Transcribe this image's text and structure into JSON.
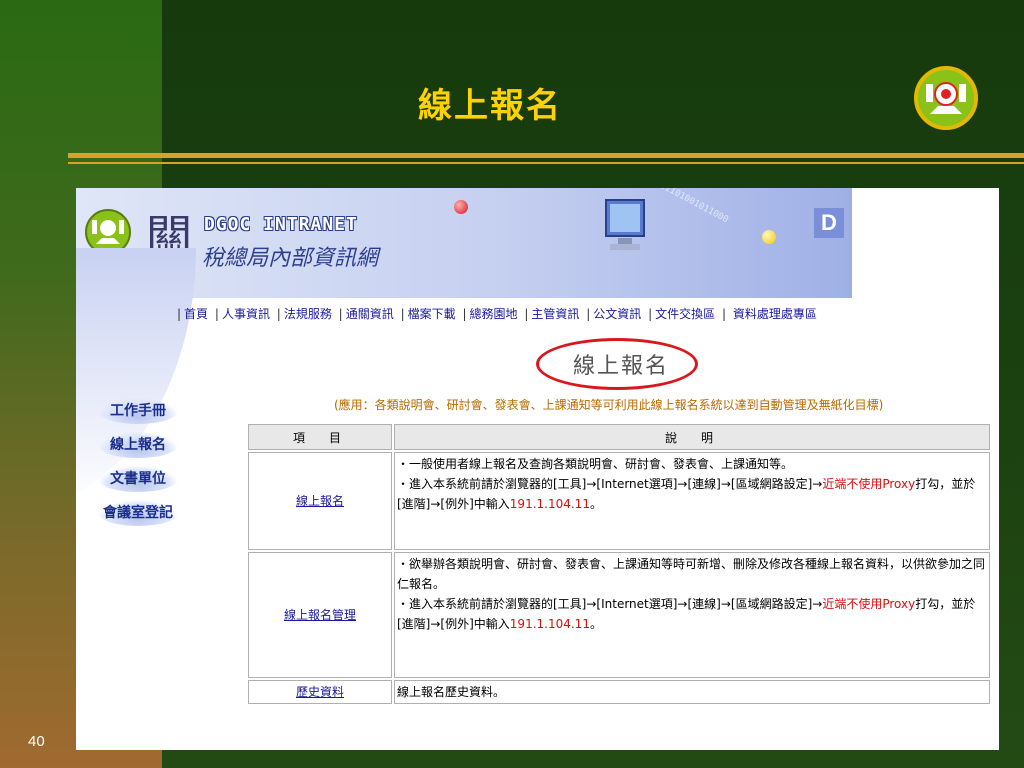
{
  "slide": {
    "title": "線上報名",
    "page_number": "40",
    "colors": {
      "title": "#ffd200",
      "rule": "#d7a12a",
      "background": "#1a3f10"
    }
  },
  "header": {
    "intranet_title": "DGOC INTRANET",
    "intranet_subtitle": "稅總局內部資訊網",
    "guan_char": "關",
    "badge_letter": "D",
    "binary_text": "01101001011000"
  },
  "nav": {
    "items": [
      "首頁",
      "人事資訊",
      "法規服務",
      "通關資訊",
      "檔案下載",
      "總務園地",
      "主管資訊",
      "公文資訊",
      "文件交換區",
      "資料處理處專區"
    ]
  },
  "sidebar": {
    "items": [
      "工作手冊",
      "線上報名",
      "文書單位",
      "會議室登記"
    ]
  },
  "main": {
    "heading": "線上報名",
    "subtitle": "(應用：各類說明會、研討會、發表會、上課通知等可利用此線上報名系統以達到自動管理及無紙化目標)",
    "table": {
      "headers": [
        "項　目",
        "說　明"
      ],
      "rows": [
        {
          "item": "線上報名",
          "line1": "・一般使用者線上報名及查詢各類說明會、研討會、發表會、上課通知等。",
          "line2a": "・進入本系統前請於瀏覽器的[工具]→[Internet選項]→[連線]→[區域網路設定]→",
          "line2red": "近端不使用Proxy",
          "line2b": "打勾，並於[進階]→[例外]中輸入",
          "ip": "191.1.104.11",
          "end": "。"
        },
        {
          "item": "線上報名管理",
          "line1": "・欲舉辦各類說明會、研討會、發表會、上課通知等時可新增、刪除及修改各種線上報名資料，以供欲參加之同仁報名。",
          "line2a": "・進入本系統前請於瀏覽器的[工具]→[Internet選項]→[連線]→[區域網路設定]→",
          "line2red": "近端不使用Proxy",
          "line2b": "打勾，並於[進階]→[例外]中輸入",
          "ip": "191.1.104.11",
          "end": "。"
        },
        {
          "item": "歷史資料",
          "line1": "線上報名歷史資料。"
        }
      ]
    },
    "colors": {
      "link": "#1a1a9a",
      "highlight": "#d41010",
      "subtitle": "#b86a00",
      "oval": "#d9181e"
    }
  }
}
